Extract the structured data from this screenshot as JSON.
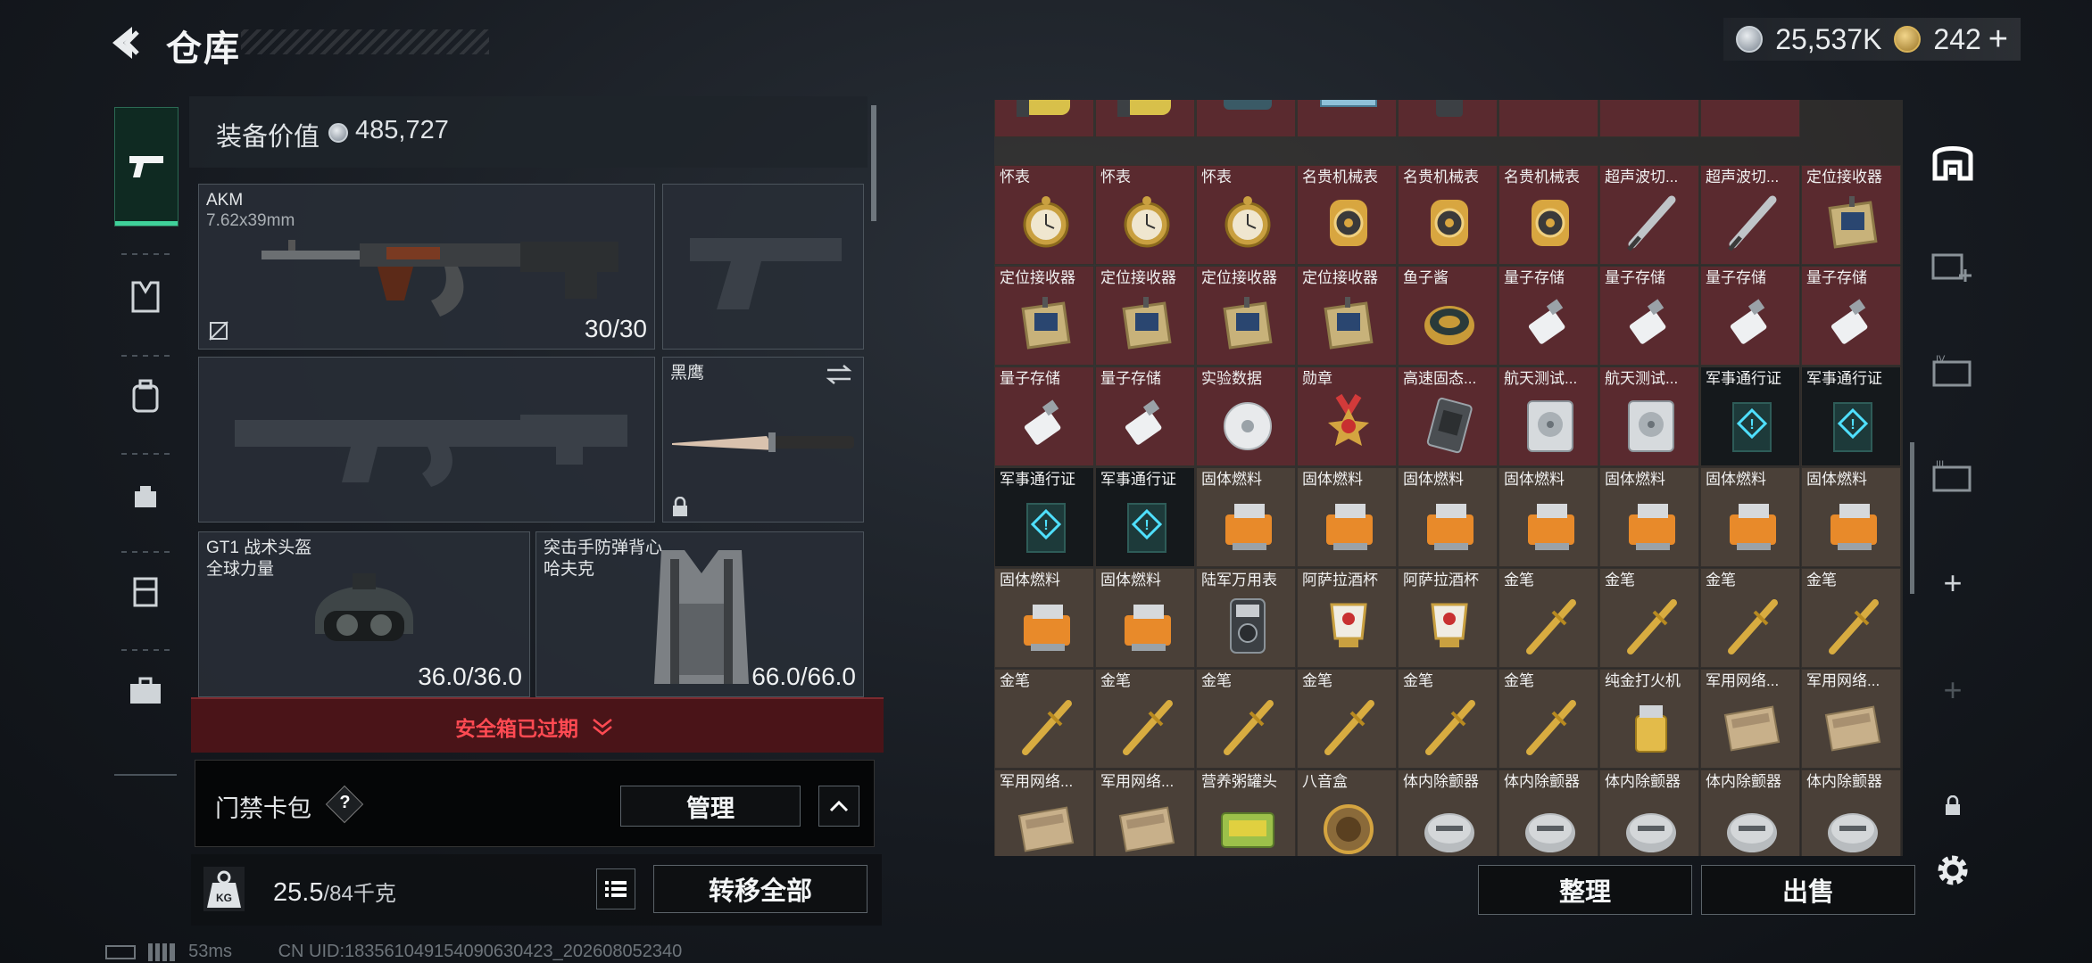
{
  "header": {
    "title": "仓库",
    "currency": [
      {
        "icon": "silver-coin-icon",
        "value": "25,537K"
      },
      {
        "icon": "gold-coin-icon",
        "value": "242"
      }
    ],
    "plus": "+"
  },
  "equipment": {
    "value_label": "装备价值",
    "value": "485,727",
    "primary": {
      "name": "AKM",
      "ammo": "7.62x39mm",
      "count": "30/30"
    },
    "melee": {
      "name": "黑鹰"
    },
    "helmet": {
      "name": "GT1 战术头盔",
      "brand": "全球力量",
      "durability": "36.0/36.0"
    },
    "vest": {
      "name": "突击手防弹背心",
      "brand": "哈夫克",
      "durability": "66.0/66.0"
    }
  },
  "safebox_status": "安全箱已过期",
  "keybag": {
    "label": "门禁卡包",
    "help": "?",
    "manage": "管理"
  },
  "weight": {
    "current": "25.5",
    "max": "/84千克"
  },
  "transfer_all": "转移全部",
  "statusbar": {
    "ping": "53ms",
    "uid": "CN UID:18356104915409063042​3_202608052340"
  },
  "stash": {
    "rows": [
      [
        {
          "n": "",
          "t": "canister"
        },
        {
          "n": "",
          "t": "canister"
        },
        {
          "n": "",
          "t": "device"
        },
        {
          "n": "",
          "t": "blue"
        },
        {
          "n": "",
          "t": "radio"
        },
        {
          "n": "",
          "t": ""
        },
        {
          "n": "",
          "t": ""
        },
        {
          "n": "",
          "t": ""
        }
      ],
      [
        {
          "n": "怀表",
          "t": "watch"
        },
        {
          "n": "怀表",
          "t": "watch"
        },
        {
          "n": "怀表",
          "t": "watch"
        },
        {
          "n": "名贵机械表",
          "t": "gold"
        },
        {
          "n": "名贵机械表",
          "t": "gold"
        },
        {
          "n": "名贵机械表",
          "t": "gold"
        },
        {
          "n": "超声波切...",
          "t": "pen"
        },
        {
          "n": "超声波切...",
          "t": "pen"
        },
        {
          "n": "定位接收器",
          "t": "locator"
        },
        {
          "n": "",
          "t": ""
        }
      ],
      [
        {
          "n": "定位接收器",
          "t": "locator"
        },
        {
          "n": "定位接收器",
          "t": "locator"
        },
        {
          "n": "定位接收器",
          "t": "locator"
        },
        {
          "n": "定位接收器",
          "t": "locator"
        },
        {
          "n": "鱼子酱",
          "t": "caviar"
        },
        {
          "n": "量子存储",
          "t": "usb"
        },
        {
          "n": "量子存储",
          "t": "usb"
        },
        {
          "n": "量子存储",
          "t": "usb"
        },
        {
          "n": "量子存储",
          "t": "usb"
        }
      ],
      [
        {
          "n": "量子存储",
          "t": "usb"
        },
        {
          "n": "量子存储",
          "t": "usb"
        },
        {
          "n": "实验数据",
          "t": "disc"
        },
        {
          "n": "勋章",
          "t": "medal"
        },
        {
          "n": "高速固态...",
          "t": "ssd"
        },
        {
          "n": "航天测试...",
          "t": "hdd"
        },
        {
          "n": "航天测试...",
          "t": "hdd"
        },
        {
          "n": "军事通行证",
          "t": "pass"
        },
        {
          "n": "军事通行证",
          "t": "pass"
        }
      ],
      [
        {
          "n": "军事通行证",
          "t": "pass"
        },
        {
          "n": "军事通行证",
          "t": "pass"
        },
        {
          "n": "固体燃料",
          "t": "fuel"
        },
        {
          "n": "固体燃料",
          "t": "fuel"
        },
        {
          "n": "固体燃料",
          "t": "fuel"
        },
        {
          "n": "固体燃料",
          "t": "fuel"
        },
        {
          "n": "固体燃料",
          "t": "fuel"
        },
        {
          "n": "固体燃料",
          "t": "fuel"
        },
        {
          "n": "固体燃料",
          "t": "fuel"
        }
      ],
      [
        {
          "n": "固体燃料",
          "t": "fuel"
        },
        {
          "n": "固体燃料",
          "t": "fuel"
        },
        {
          "n": "陆军万用表",
          "t": "meter"
        },
        {
          "n": "阿萨拉酒杯",
          "t": "cup"
        },
        {
          "n": "阿萨拉酒杯",
          "t": "cup"
        },
        {
          "n": "金笔",
          "t": "goldpen"
        },
        {
          "n": "金笔",
          "t": "goldpen"
        },
        {
          "n": "金笔",
          "t": "goldpen"
        },
        {
          "n": "金笔",
          "t": "goldpen"
        }
      ],
      [
        {
          "n": "金笔",
          "t": "goldpen"
        },
        {
          "n": "金笔",
          "t": "goldpen"
        },
        {
          "n": "金笔",
          "t": "goldpen"
        },
        {
          "n": "金笔",
          "t": "goldpen"
        },
        {
          "n": "金笔",
          "t": "goldpen"
        },
        {
          "n": "金笔",
          "t": "goldpen"
        },
        {
          "n": "纯金打火机",
          "t": "lighter"
        },
        {
          "n": "军用网络...",
          "t": "net"
        },
        {
          "n": "军用网络...",
          "t": "net"
        }
      ],
      [
        {
          "n": "军用网络...",
          "t": "net"
        },
        {
          "n": "军用网络...",
          "t": "net"
        },
        {
          "n": "营养粥罐头",
          "t": "can"
        },
        {
          "n": "八音盒",
          "t": "musicbox"
        },
        {
          "n": "体内除颤器",
          "t": "defib"
        },
        {
          "n": "体内除颤器",
          "t": "defib"
        },
        {
          "n": "体内除颤器",
          "t": "defib"
        },
        {
          "n": "体内除颤器",
          "t": "defib"
        },
        {
          "n": "体内除颤器",
          "t": "defib"
        }
      ]
    ]
  },
  "sort_button": "整理",
  "sell_button": "出售",
  "right_nav": {
    "add": "+"
  },
  "colors": {
    "accent": "#3fd19a",
    "expired": "#ff4a52",
    "maroon_cell": "#5a2a2f",
    "brown_cell": "#4a4038",
    "dark_cell": "#15191c"
  }
}
